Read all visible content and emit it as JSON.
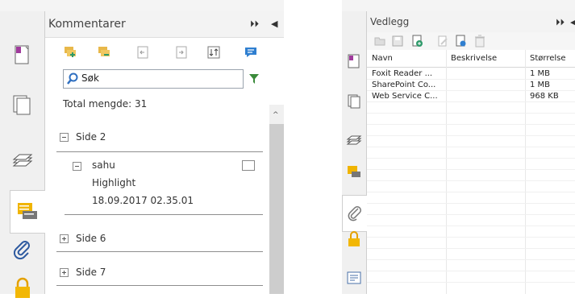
{
  "comments_panel": {
    "title": "Kommentarer",
    "pin_label": "⏵⏵",
    "collapse_label": "◀",
    "search": {
      "value": "Søk"
    },
    "total": "Total mengde: 31",
    "groups": [
      {
        "label": "Side 2",
        "expanded": true
      },
      {
        "label": "Side 6",
        "expanded": false
      },
      {
        "label": "Side 7",
        "expanded": false
      }
    ],
    "comment": {
      "author": "sahu",
      "type": "Highlight",
      "date": "18.09.2017 02.35.01"
    }
  },
  "attachments_panel": {
    "title": "Vedlegg",
    "pin_label": "⏵⏵",
    "collapse_label": "◀",
    "columns": [
      "Navn",
      "Beskrivelse",
      "Størrelse"
    ],
    "rows": [
      {
        "name": "Foxit Reader ...",
        "description": "",
        "size": "1 MB"
      },
      {
        "name": "SharePoint Co...",
        "description": "",
        "size": "1 MB"
      },
      {
        "name": "Web Service C...",
        "description": "",
        "size": "968 KB"
      }
    ]
  },
  "colors": {
    "accent_yellow": "#f0b400",
    "accent_green": "#2e9a6a",
    "filter_green": "#3a8a3a",
    "comment_blue": "#2f7fd0"
  }
}
